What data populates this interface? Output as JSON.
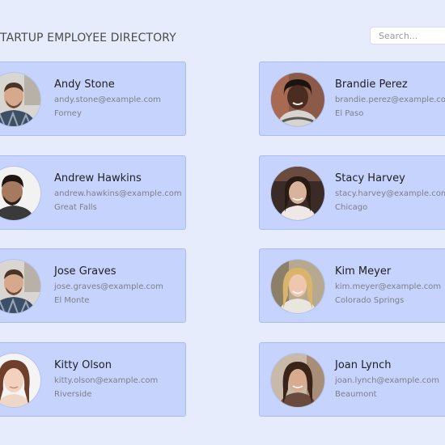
{
  "header": {
    "title": "TARTUP EMPLOYEE DIRECTORY"
  },
  "search": {
    "placeholder": "Search..."
  },
  "employees": [
    {
      "name": "Andy Stone",
      "email": "andy.stone@example.com",
      "city": "Forney"
    },
    {
      "name": "Brandie Perez",
      "email": "brandie.perez@example.com",
      "city": "El Paso"
    },
    {
      "name": "Andrew Hawkins",
      "email": "andrew.hawkins@example.com",
      "city": "Great Falls"
    },
    {
      "name": "Stacy Harvey",
      "email": "stacy.harvey@example.com",
      "city": "Chicago"
    },
    {
      "name": "Jose Graves",
      "email": "jose.graves@example.com",
      "city": "El Monte"
    },
    {
      "name": "Kim Meyer",
      "email": "kim.meyer@example.com",
      "city": "Colorado Springs"
    },
    {
      "name": "Kitty Olson",
      "email": "kitty.olson@example.com",
      "city": "Riverside"
    },
    {
      "name": "Joan Lynch",
      "email": "joan.lynch@example.com",
      "city": "Beaumont"
    }
  ],
  "colors": {
    "page_background": "#e7ecfd",
    "card_background": "#c6d3fd",
    "card_border": "#a9bbf3"
  }
}
